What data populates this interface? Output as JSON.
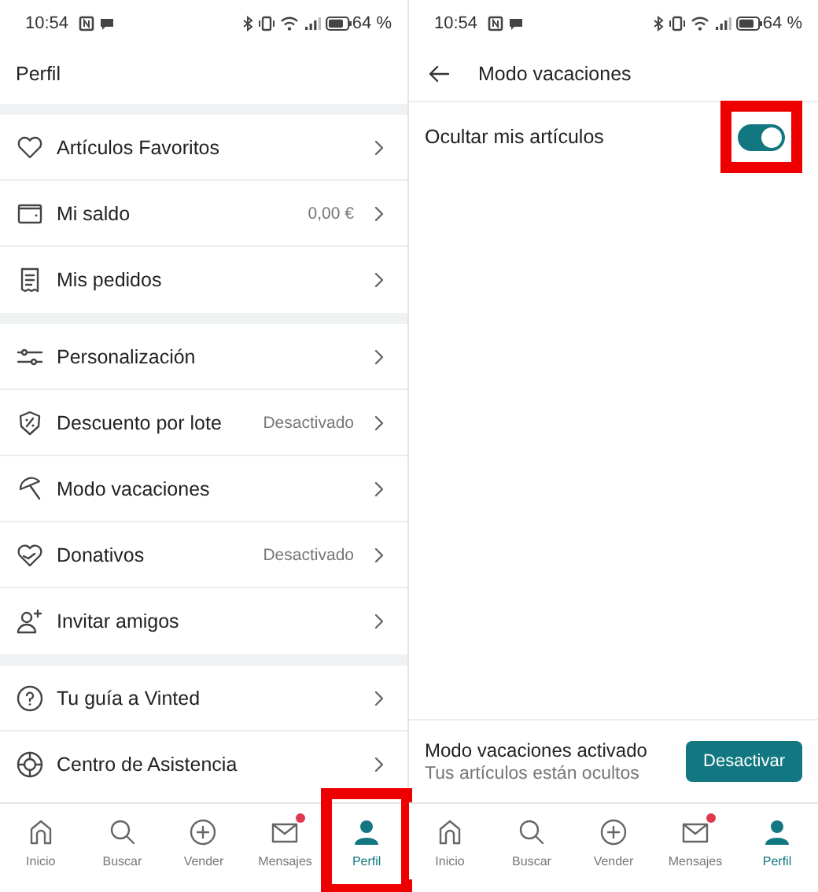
{
  "screens": [
    {
      "kind": "profile",
      "status_bar": {
        "time": "10:54",
        "battery": "64 %"
      },
      "header": {
        "title": "Perfil"
      },
      "sections": [
        {
          "items": [
            {
              "label": "Artículos Favoritos"
            },
            {
              "label": "Mi saldo",
              "value": "0,00 €"
            },
            {
              "label": "Mis pedidos"
            }
          ]
        },
        {
          "items": [
            {
              "label": "Personalización"
            },
            {
              "label": "Descuento por lote",
              "value": "Desactivado"
            },
            {
              "label": "Modo vacaciones"
            },
            {
              "label": "Donativos",
              "value": "Desactivado"
            },
            {
              "label": "Invitar amigos"
            }
          ]
        },
        {
          "items": [
            {
              "label": "Tu guía a Vinted"
            },
            {
              "label": "Centro de Asistencia"
            }
          ]
        }
      ],
      "nav": [
        {
          "label": "Inicio",
          "selected": false,
          "badge": false,
          "highlighted": false
        },
        {
          "label": "Buscar",
          "selected": false,
          "badge": false,
          "highlighted": false
        },
        {
          "label": "Vender",
          "selected": false,
          "badge": false,
          "highlighted": false
        },
        {
          "label": "Mensajes",
          "selected": false,
          "badge": true,
          "highlighted": false
        },
        {
          "label": "Perfil",
          "selected": true,
          "badge": false,
          "highlighted": true
        }
      ]
    },
    {
      "kind": "vacation",
      "status_bar": {
        "time": "10:54",
        "battery": "64 %"
      },
      "header": {
        "title": "Modo vacaciones"
      },
      "settings": [
        {
          "label": "Ocultar mis artículos",
          "on": true,
          "highlighted": true
        }
      ],
      "banner": {
        "title": "Modo vacaciones activado",
        "subtitle": "Tus artículos están ocultos",
        "button": "Desactivar"
      },
      "nav": [
        {
          "label": "Inicio",
          "selected": false,
          "badge": false,
          "highlighted": false
        },
        {
          "label": "Buscar",
          "selected": false,
          "badge": false,
          "highlighted": false
        },
        {
          "label": "Vender",
          "selected": false,
          "badge": false,
          "highlighted": false
        },
        {
          "label": "Mensajes",
          "selected": false,
          "badge": true,
          "highlighted": false
        },
        {
          "label": "Perfil",
          "selected": true,
          "badge": false,
          "highlighted": false
        }
      ]
    }
  ]
}
